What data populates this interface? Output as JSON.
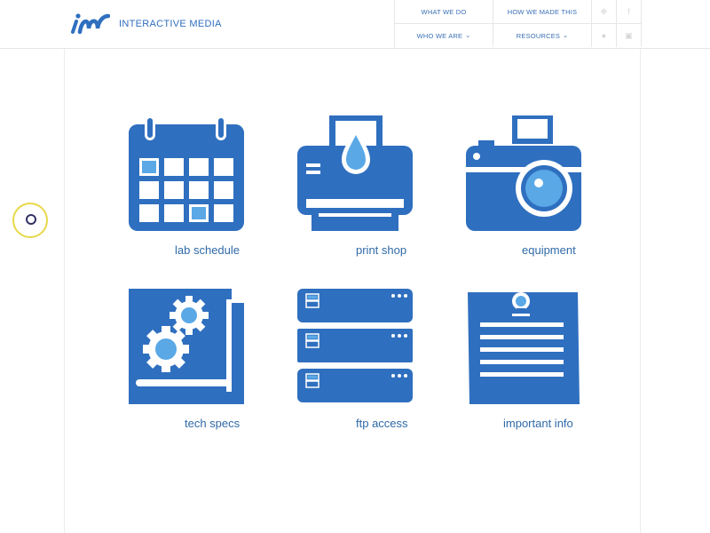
{
  "brand": {
    "name": "INTERACTIVE MEDIA",
    "logo": "im-logo"
  },
  "nav": {
    "what_we_do": "WHAT WE DO",
    "how_we_made_this": "HOW WE MADE THIS",
    "who_we_are": "WHO WE ARE",
    "resources": "RESOURCES",
    "social": [
      "twitter-icon",
      "facebook-icon",
      "pinterest-icon",
      "instagram-icon"
    ]
  },
  "tiles": [
    {
      "label": "lab schedule",
      "icon": "calendar-icon"
    },
    {
      "label": "print shop",
      "icon": "printer-icon"
    },
    {
      "label": "equipment",
      "icon": "camera-icon"
    },
    {
      "label": "tech specs",
      "icon": "gears-icon"
    },
    {
      "label": "ftp access",
      "icon": "server-icon"
    },
    {
      "label": "important info",
      "icon": "notepad-icon"
    }
  ],
  "colors": {
    "primary": "#2f6fbf",
    "accent": "#5aa8e6",
    "label": "#2f6aa8"
  }
}
